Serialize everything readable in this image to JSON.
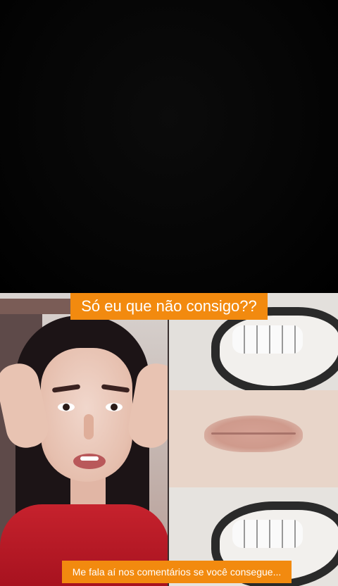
{
  "video": {
    "caption_top": "Só eu que não consigo??",
    "caption_bottom": "Me fala aí nos comentários se você consegue..."
  },
  "colors": {
    "caption_bg": "#f28a0f",
    "caption_text": "#ffffff",
    "background": "#000000"
  }
}
